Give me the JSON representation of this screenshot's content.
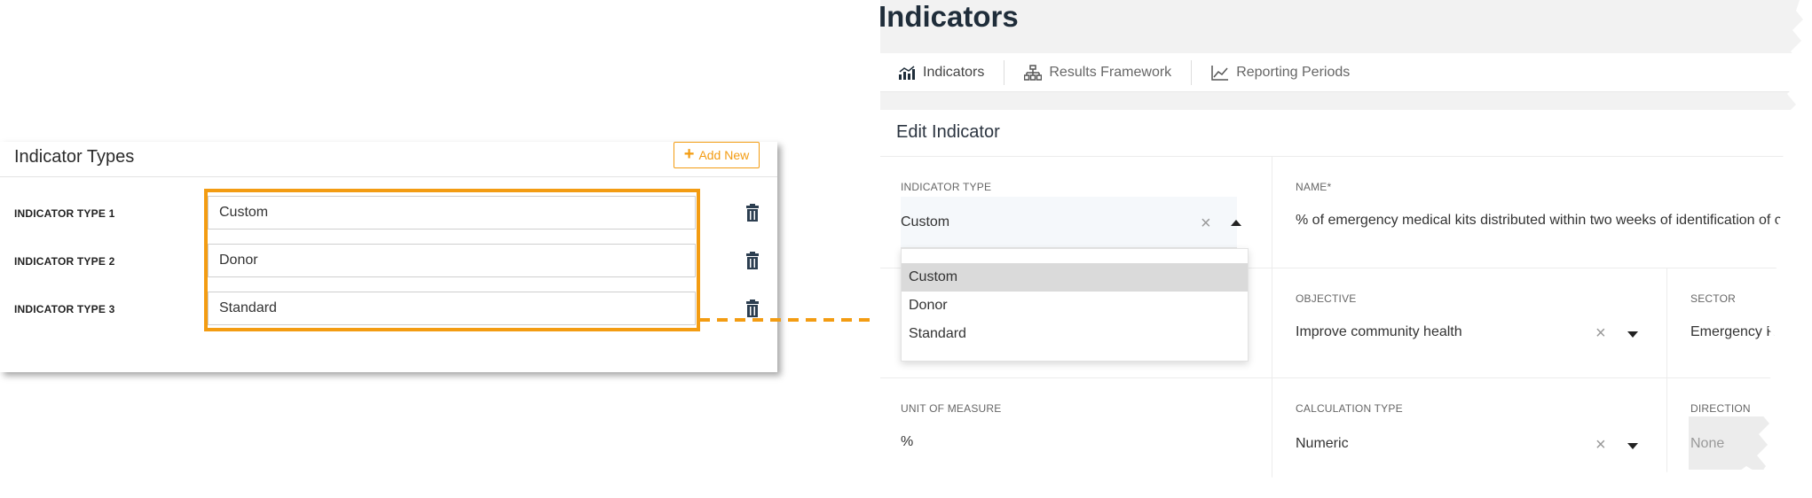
{
  "indicator_types_panel": {
    "title": "Indicator Types",
    "add_new_label": "Add New",
    "rows": [
      {
        "label": "INDICATOR TYPE 1",
        "value": "Custom"
      },
      {
        "label": "INDICATOR TYPE 2",
        "value": "Donor"
      },
      {
        "label": "INDICATOR TYPE 3",
        "value": "Standard"
      }
    ]
  },
  "indicators_page": {
    "title": "Indicators",
    "tabs": [
      {
        "label": "Indicators",
        "icon": "indicators-chart-icon"
      },
      {
        "label": "Results Framework",
        "icon": "hierarchy-icon"
      },
      {
        "label": "Reporting Periods",
        "icon": "line-chart-icon"
      }
    ],
    "edit_title": "Edit Indicator",
    "fields": {
      "indicator_type": {
        "label": "INDICATOR TYPE",
        "value": "Custom"
      },
      "name": {
        "label": "NAME*",
        "value": "% of emergency medical kits distributed within two weeks of identification of cri"
      },
      "objective": {
        "label": "OBJECTIVE",
        "value": "Improve community health"
      },
      "sector": {
        "label": "SECTOR",
        "value": "Emergency Respo"
      },
      "unit_of_measure": {
        "label": "UNIT OF MEASURE",
        "value": "%"
      },
      "calculation_type": {
        "label": "CALCULATION TYPE",
        "value": "Numeric"
      },
      "direction": {
        "label": "DIRECTION",
        "value": "None"
      }
    },
    "dropdown_options": [
      "Custom",
      "Donor",
      "Standard"
    ],
    "dropdown_selected": "Custom"
  },
  "colors": {
    "accent": "#f39c12",
    "title": "#1f2d3a",
    "trash": "#2c3e50"
  }
}
